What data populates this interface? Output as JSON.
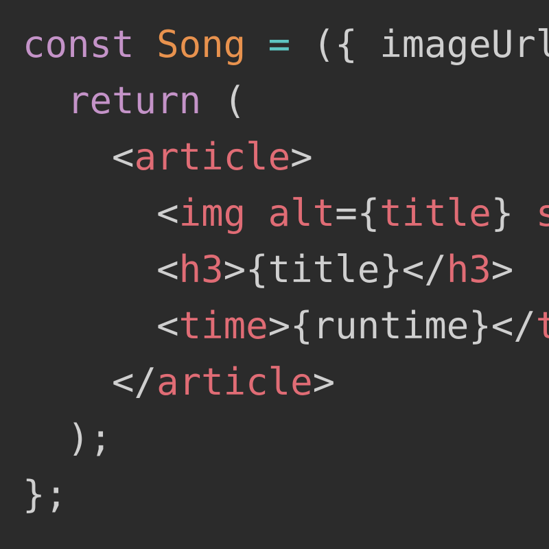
{
  "editor": {
    "background": "#2b2b2b",
    "colors": {
      "keyword": "#c493c8",
      "variable": "#e8924e",
      "operator": "#5ec4c2",
      "tag": "#e06c75",
      "text": "#cfcfcf"
    },
    "lines": [
      {
        "indent": "",
        "tokens": [
          {
            "text": "const",
            "kind": "keyword"
          },
          {
            "text": " ",
            "kind": "text"
          },
          {
            "text": "Song",
            "kind": "variable"
          },
          {
            "text": " ",
            "kind": "text"
          },
          {
            "text": "=",
            "kind": "operator"
          },
          {
            "text": " ({ imageUrl",
            "kind": "text"
          }
        ]
      },
      {
        "indent": "  ",
        "tokens": [
          {
            "text": "return",
            "kind": "keyword"
          },
          {
            "text": " (",
            "kind": "text"
          }
        ]
      },
      {
        "indent": "    ",
        "tokens": [
          {
            "text": "<",
            "kind": "text"
          },
          {
            "text": "article",
            "kind": "tag"
          },
          {
            "text": ">",
            "kind": "text"
          }
        ]
      },
      {
        "indent": "      ",
        "tokens": [
          {
            "text": "<",
            "kind": "text"
          },
          {
            "text": "img",
            "kind": "tag"
          },
          {
            "text": " ",
            "kind": "text"
          },
          {
            "text": "alt",
            "kind": "tag"
          },
          {
            "text": "=",
            "kind": "text"
          },
          {
            "text": "{",
            "kind": "text"
          },
          {
            "text": "title",
            "kind": "tag"
          },
          {
            "text": "} ",
            "kind": "text"
          },
          {
            "text": "src",
            "kind": "tag"
          }
        ]
      },
      {
        "indent": "      ",
        "tokens": [
          {
            "text": "<",
            "kind": "text"
          },
          {
            "text": "h3",
            "kind": "tag"
          },
          {
            "text": ">{title}</",
            "kind": "text"
          },
          {
            "text": "h3",
            "kind": "tag"
          },
          {
            "text": ">",
            "kind": "text"
          }
        ]
      },
      {
        "indent": "      ",
        "tokens": [
          {
            "text": "<",
            "kind": "text"
          },
          {
            "text": "time",
            "kind": "tag"
          },
          {
            "text": ">{runtime}</",
            "kind": "text"
          },
          {
            "text": "time",
            "kind": "tag"
          },
          {
            "text": ">",
            "kind": "text"
          }
        ]
      },
      {
        "indent": "    ",
        "tokens": [
          {
            "text": "</",
            "kind": "text"
          },
          {
            "text": "article",
            "kind": "tag"
          },
          {
            "text": ">",
            "kind": "text"
          }
        ]
      },
      {
        "indent": "  ",
        "tokens": [
          {
            "text": ");",
            "kind": "text"
          }
        ]
      },
      {
        "indent": "",
        "tokens": [
          {
            "text": "};",
            "kind": "text"
          }
        ]
      }
    ]
  }
}
